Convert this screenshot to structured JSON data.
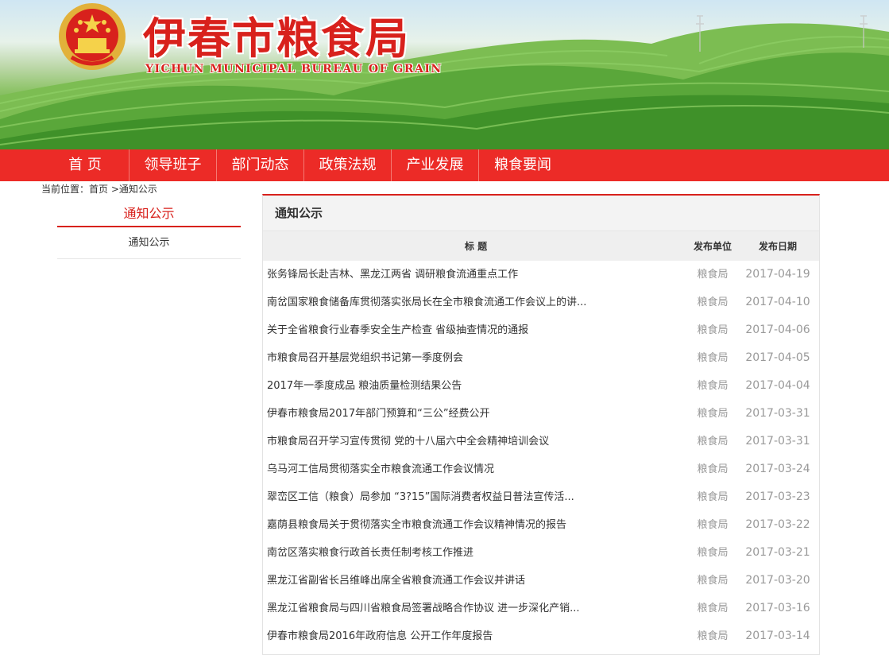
{
  "header": {
    "title": "伊春市粮食局",
    "subtitle": "YICHUN MUNICIPAL BUREAU OF GRAIN",
    "emblem_icon": "national-emblem-icon"
  },
  "nav": {
    "items": [
      "首 页",
      "领导班子",
      "部门动态",
      "政策法规",
      "产业发展",
      "粮食要闻"
    ]
  },
  "breadcrumb": {
    "label": "当前位置：",
    "home": "首页",
    "separator": " >",
    "current": "通知公示"
  },
  "sidebar": {
    "title": "通知公示",
    "items": [
      "通知公示"
    ]
  },
  "main": {
    "title": "通知公示",
    "columns": {
      "title": "标 题",
      "unit": "发布单位",
      "date": "发布日期"
    },
    "rows": [
      {
        "title": "张务锋局长赴吉林、黑龙江两省 调研粮食流通重点工作",
        "unit": "粮食局",
        "date": "2017-04-19"
      },
      {
        "title": "南岔国家粮食储备库贯彻落实张局长在全市粮食流通工作会议上的讲...",
        "unit": "粮食局",
        "date": "2017-04-10"
      },
      {
        "title": "关于全省粮食行业春季安全生产检查 省级抽查情况的通报",
        "unit": "粮食局",
        "date": "2017-04-06"
      },
      {
        "title": "市粮食局召开基层党组织书记第一季度例会",
        "unit": "粮食局",
        "date": "2017-04-05"
      },
      {
        "title": "2017年一季度成品 粮油质量检测结果公告",
        "unit": "粮食局",
        "date": "2017-04-04"
      },
      {
        "title": "伊春市粮食局2017年部门预算和“三公”经费公开",
        "unit": "粮食局",
        "date": "2017-03-31"
      },
      {
        "title": "市粮食局召开学习宣传贯彻 党的十八届六中全会精神培训会议",
        "unit": "粮食局",
        "date": "2017-03-31"
      },
      {
        "title": "乌马河工信局贯彻落实全市粮食流通工作会议情况",
        "unit": "粮食局",
        "date": "2017-03-24"
      },
      {
        "title": "翠峦区工信（粮食）局参加 “3?15”国际消费者权益日普法宣传活...",
        "unit": "粮食局",
        "date": "2017-03-23"
      },
      {
        "title": "嘉荫县粮食局关于贯彻落实全市粮食流通工作会议精神情况的报告",
        "unit": "粮食局",
        "date": "2017-03-22"
      },
      {
        "title": "南岔区落实粮食行政首长责任制考核工作推进",
        "unit": "粮食局",
        "date": "2017-03-21"
      },
      {
        "title": "黑龙江省副省长吕维峰出席全省粮食流通工作会议并讲话",
        "unit": "粮食局",
        "date": "2017-03-20"
      },
      {
        "title": "黑龙江省粮食局与四川省粮食局签署战略合作协议 进一步深化产销...",
        "unit": "粮食局",
        "date": "2017-03-16"
      },
      {
        "title": "伊春市粮食局2016年政府信息 公开工作年度报告",
        "unit": "粮食局",
        "date": "2017-03-14"
      }
    ]
  },
  "colors": {
    "brand_red": "#d8211c",
    "nav_red": "#ec2b27",
    "muted_text": "#999999"
  }
}
